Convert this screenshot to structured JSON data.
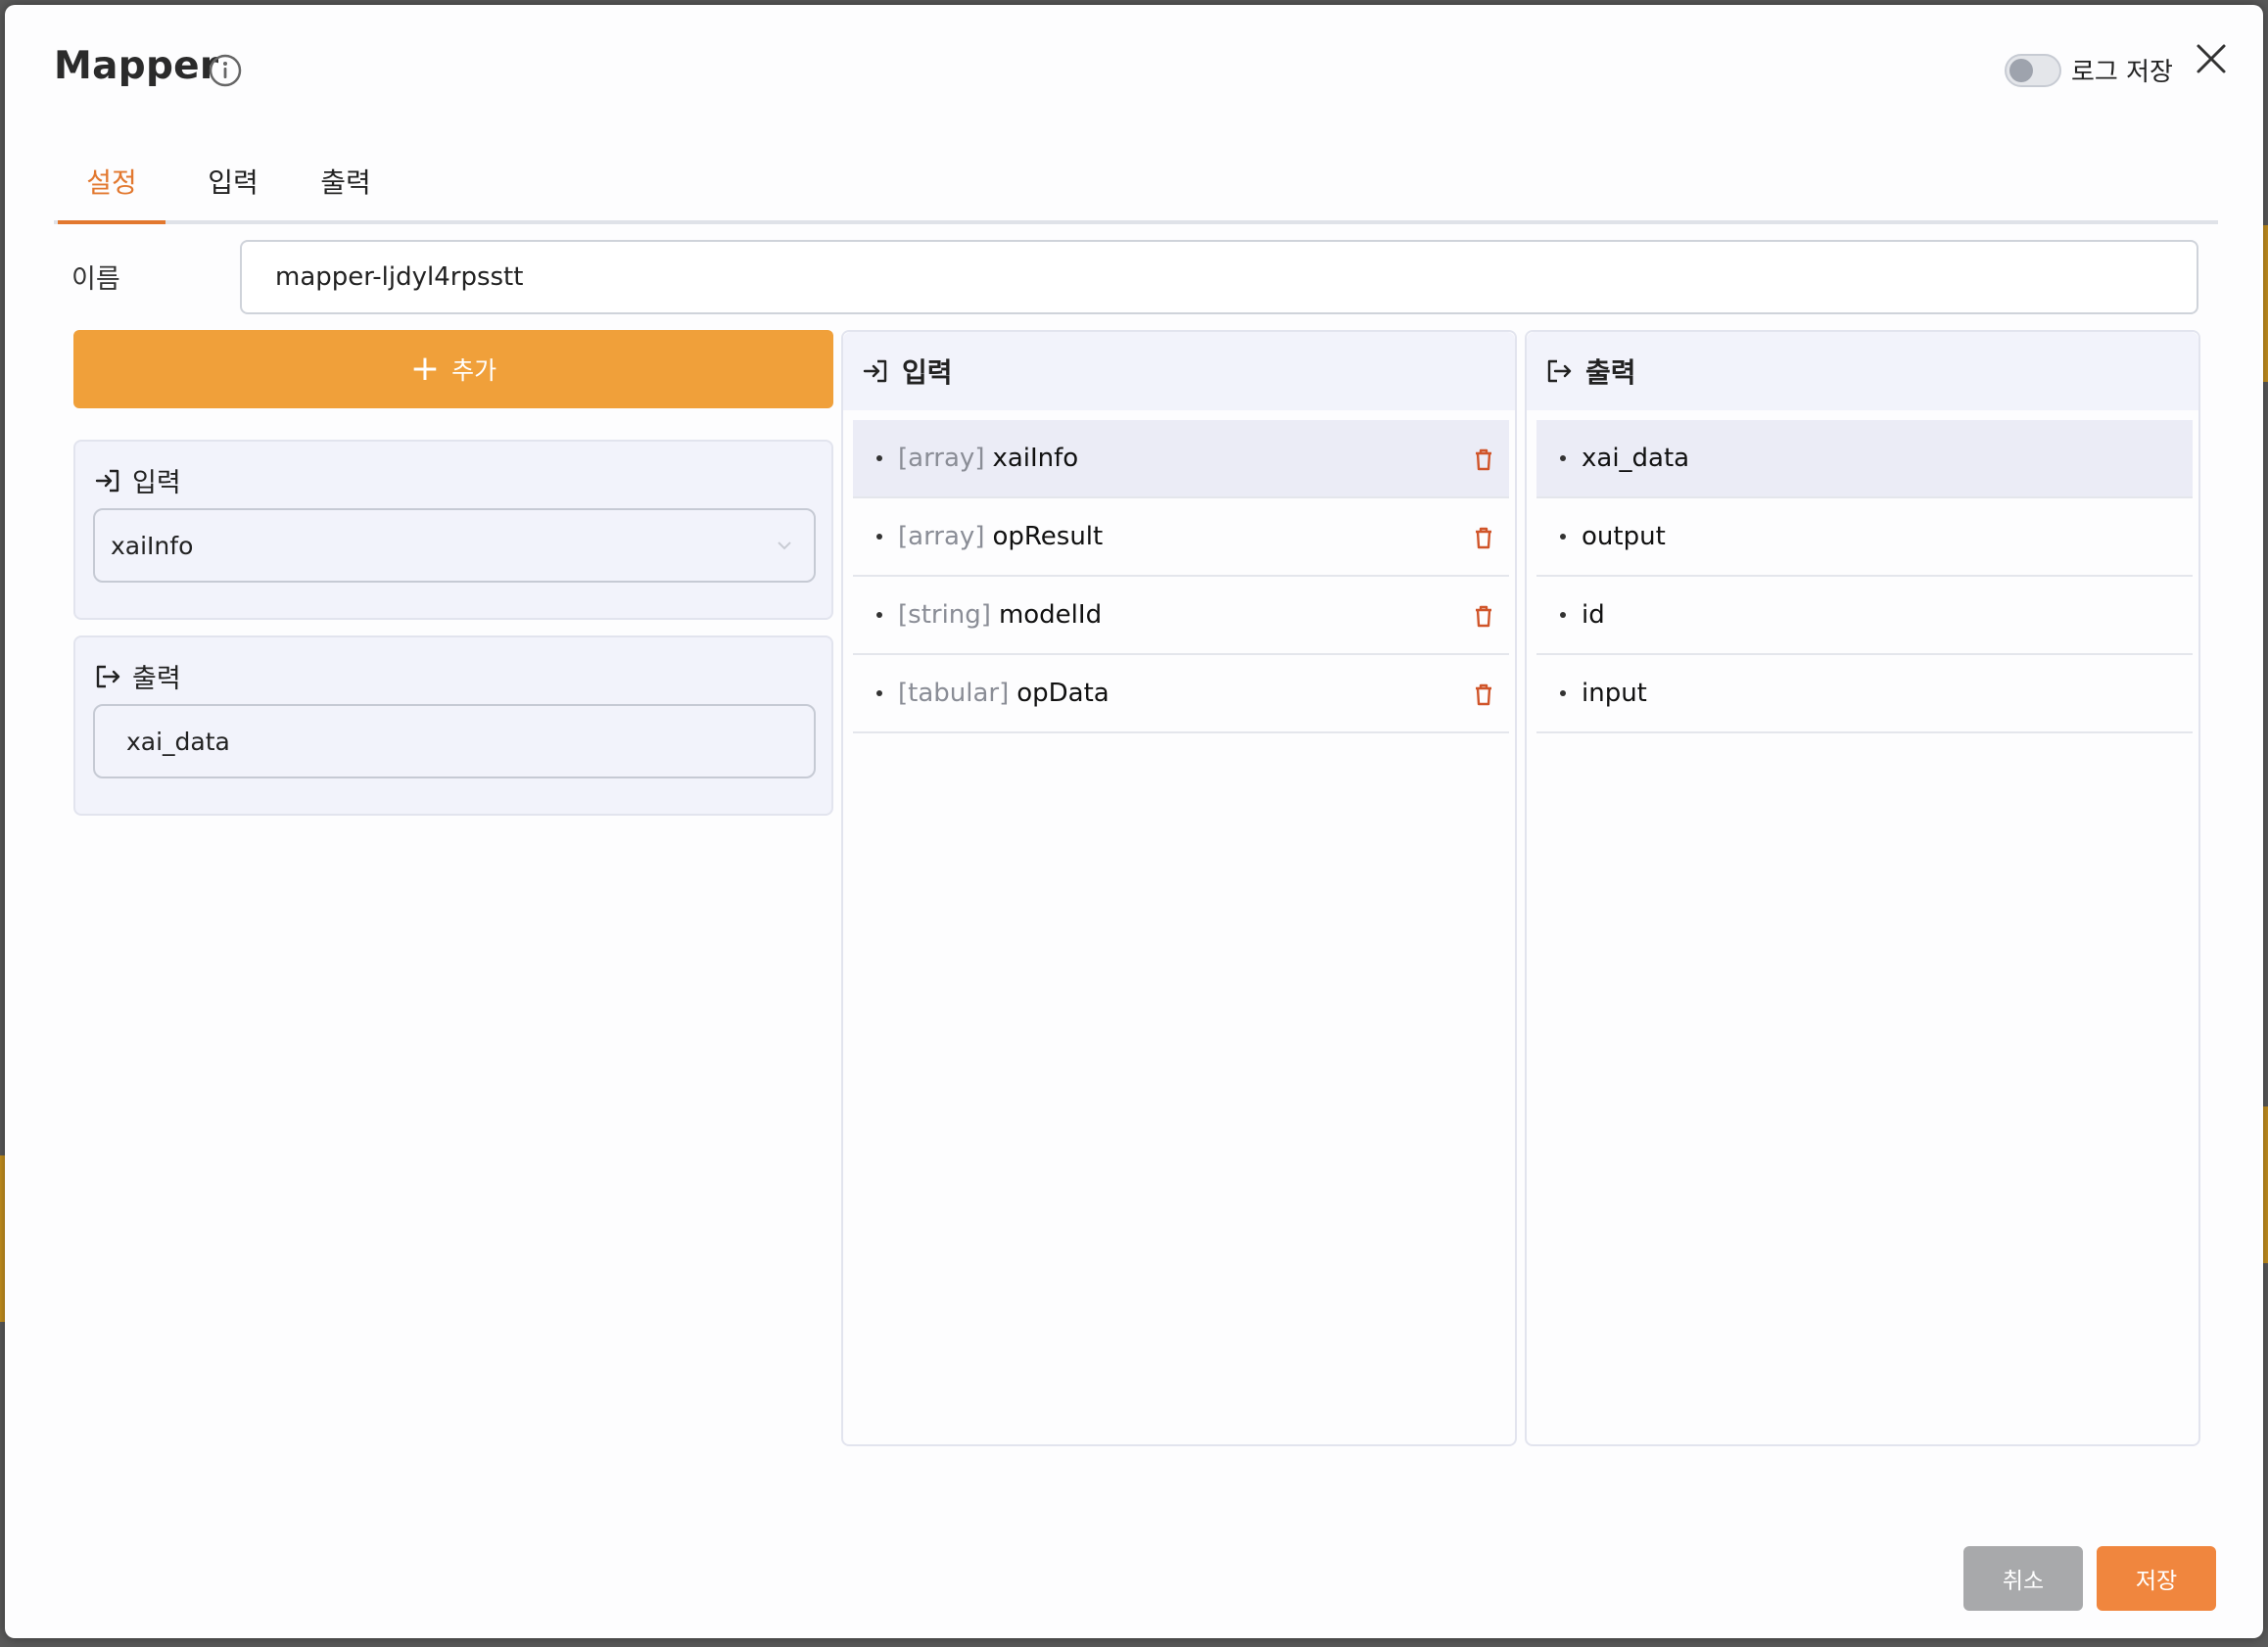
{
  "dialog": {
    "title": "Mapper",
    "log_toggle_label": "로그 저장",
    "log_toggle_on": false
  },
  "tabs": [
    {
      "label": "설정",
      "active": true
    },
    {
      "label": "입력",
      "active": false
    },
    {
      "label": "출력",
      "active": false
    }
  ],
  "settings": {
    "name_label": "이름",
    "name_value": "mapper-ljdyl4rpsstt",
    "add_label": "추가",
    "mapping": {
      "input_label": "입력",
      "input_value": "xaiInfo",
      "output_label": "출력",
      "output_value": "xai_data"
    }
  },
  "input_panel": {
    "title": "입력",
    "items": [
      {
        "type": "[array]",
        "name": "xaiInfo",
        "selected": true
      },
      {
        "type": "[array]",
        "name": "opResult",
        "selected": false
      },
      {
        "type": "[string]",
        "name": "modelId",
        "selected": false
      },
      {
        "type": "[tabular]",
        "name": "opData",
        "selected": false
      }
    ]
  },
  "output_panel": {
    "title": "출력",
    "items": [
      {
        "name": "xai_data",
        "selected": true
      },
      {
        "name": "output",
        "selected": false
      },
      {
        "name": "id",
        "selected": false
      },
      {
        "name": "input",
        "selected": false
      }
    ]
  },
  "footer": {
    "cancel_label": "취소",
    "save_label": "저장"
  },
  "colors": {
    "accent": "#e2782f",
    "add_button": "#f0a03a",
    "save_button": "#f0863e",
    "cancel_button": "#a8a9ab",
    "delete_icon": "#d0552a"
  },
  "icons": {
    "info": "info-icon",
    "close": "close-icon",
    "input": "sign-in-icon",
    "output": "sign-out-icon",
    "delete": "trash-icon",
    "add": "plus-icon",
    "dropdown": "chevron-down-icon"
  }
}
